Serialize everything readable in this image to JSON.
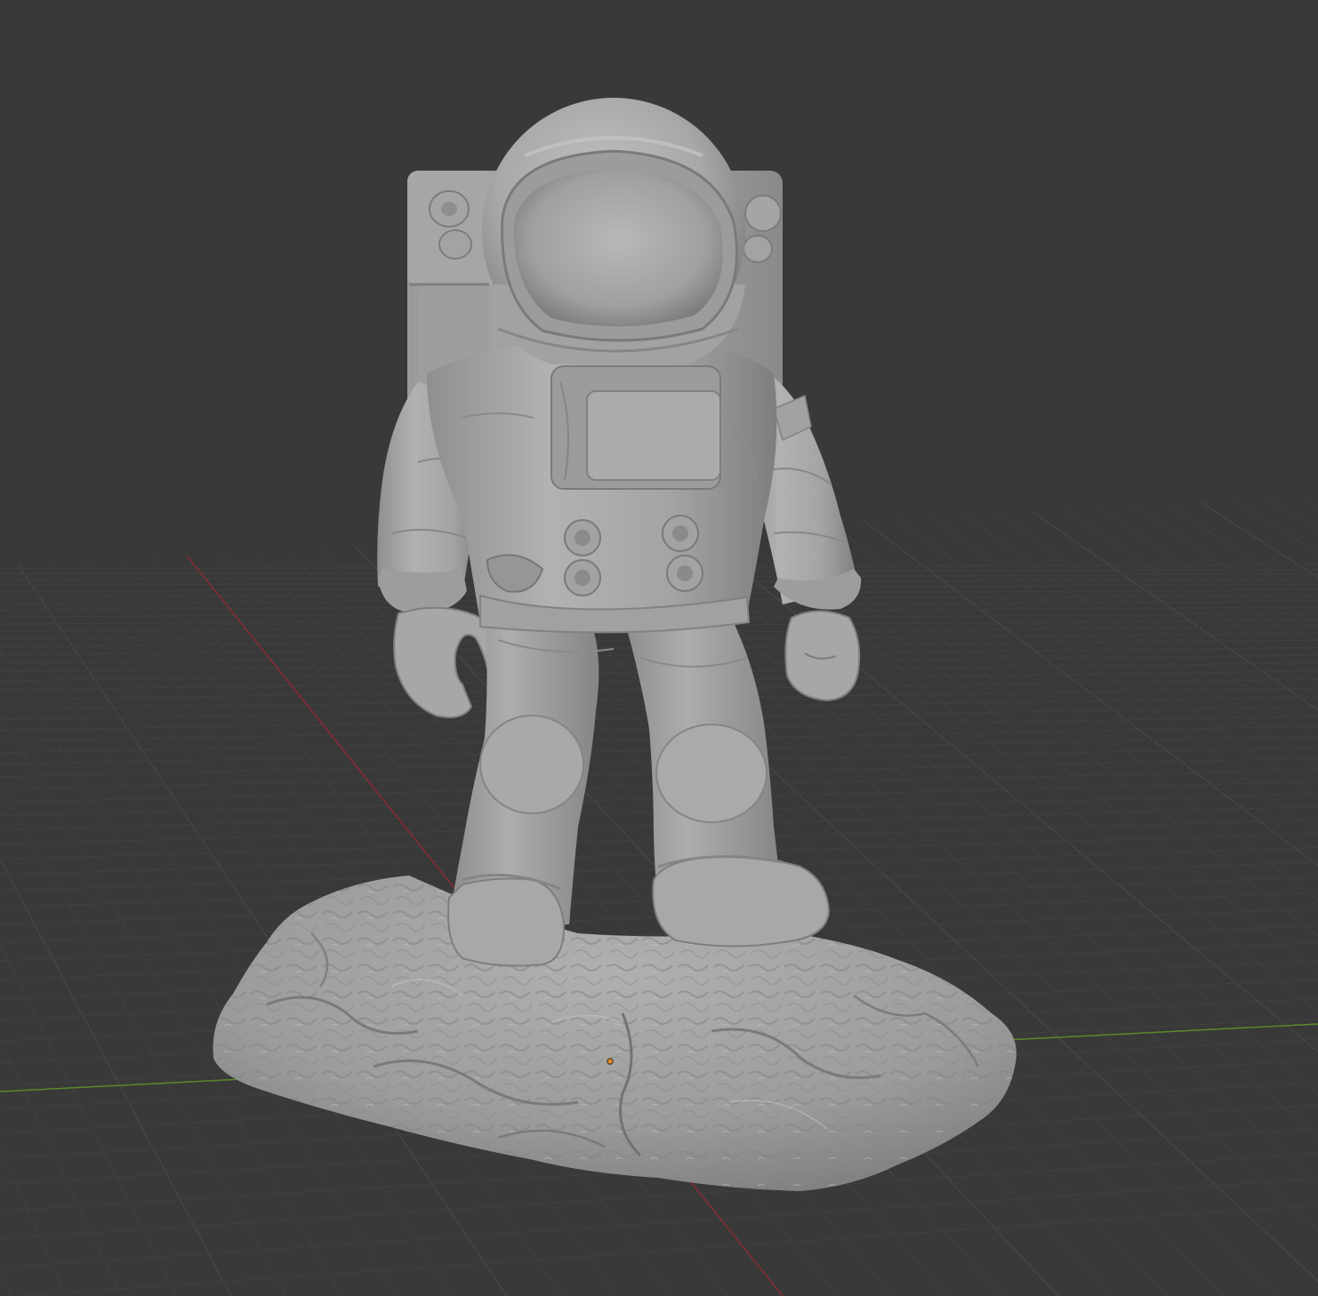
{
  "viewport": {
    "editor": "3D Viewport",
    "shading_mode": "solid",
    "background_color": "#393939",
    "grid_color": "#4a4a4a",
    "grid_color_minor": "#414141",
    "x_axis_color": "#8a2a33",
    "y_axis_color": "#5a8a2a",
    "origin_color": "#e08a2a",
    "model_color": "#a9a9a9"
  },
  "scene": {
    "object": "astronaut-statue",
    "object_parts": [
      "helmet",
      "visor",
      "backpack",
      "chest-control-box",
      "torso",
      "left-arm",
      "right-arm",
      "left-leg",
      "right-leg",
      "rock-base"
    ]
  }
}
